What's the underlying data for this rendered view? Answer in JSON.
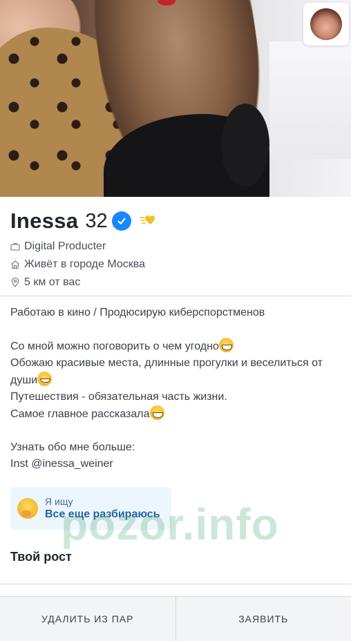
{
  "profile": {
    "name": "Inessa",
    "age": "32",
    "job": "Digital Producter",
    "city": "Живёт в городе Москва",
    "distance": "5 км от вас"
  },
  "bio": {
    "line1": "Работаю в кино / Продюсирую киберспорстменов",
    "line2": "Со мной можно поговорить о чем угодно",
    "line3": "Обожаю красивые места, длинные прогулки и веселиться от",
    "line4": "души",
    "line5": "Путешествия - обязательная часть жизни.",
    "line6": "Самое главное рассказала",
    "line7": "Узнать обо мне больше:",
    "line8": "Inst @inessa_weiner"
  },
  "looking_for": {
    "label": "Я ищу",
    "value": "Все еще разбираюсь"
  },
  "height": {
    "title": "Твой рост"
  },
  "watermark": "pozor.info",
  "footer": {
    "unmatch_label": "УДАЛИТЬ ИЗ ПАР",
    "report_label": "ЗАЯВИТЬ"
  },
  "colors": {
    "verified": "#1786ff",
    "looking_bg": "#eef6fd",
    "looking_text": "#1f64a8"
  }
}
